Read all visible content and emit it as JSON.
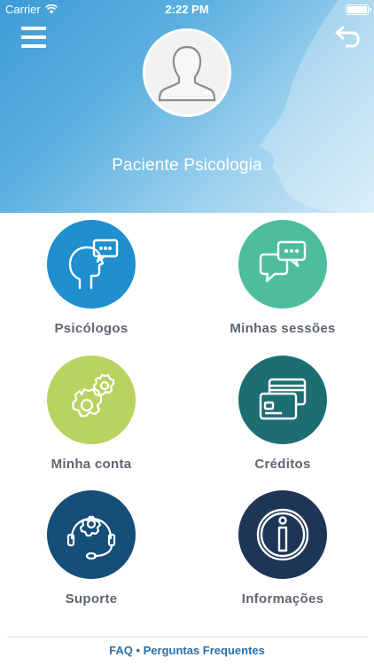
{
  "status_bar": {
    "carrier": "Carrier",
    "time": "2:22 PM"
  },
  "profile": {
    "name": "Paciente Psicologia"
  },
  "tiles": [
    {
      "label": "Psicólogos",
      "color": "#1f8fcf",
      "icon": "head-chat-icon"
    },
    {
      "label": "Minhas sessões",
      "color": "#4dbd9e",
      "icon": "chat-bubbles-icon"
    },
    {
      "label": "Minha conta",
      "color": "#b8d35f",
      "icon": "gears-icon"
    },
    {
      "label": "Créditos",
      "color": "#1d6e72",
      "icon": "credit-cards-icon"
    },
    {
      "label": "Suporte",
      "color": "#154e78",
      "icon": "headset-gear-icon"
    },
    {
      "label": "Informações",
      "color": "#1e3556",
      "icon": "info-icon"
    }
  ],
  "footer": {
    "link": "FAQ • Perguntas Frequentes"
  }
}
